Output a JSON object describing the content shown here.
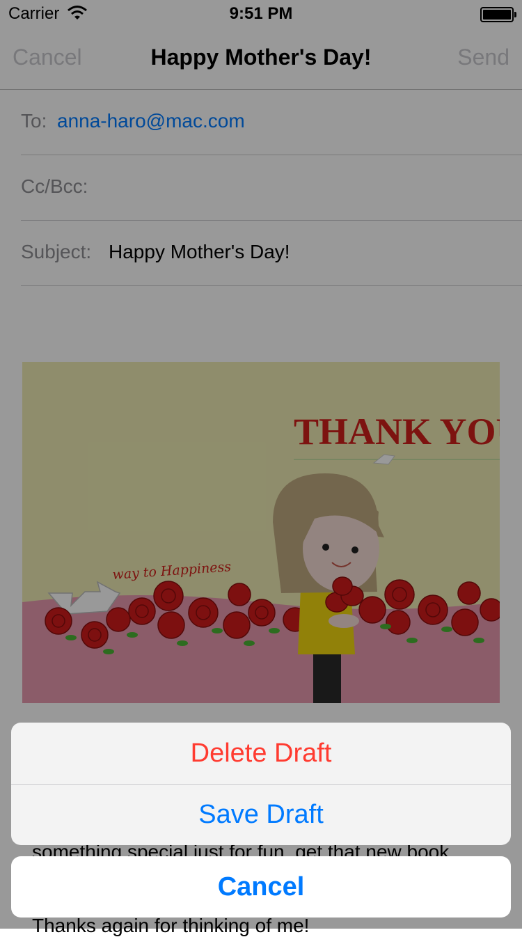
{
  "status_bar": {
    "carrier": "Carrier",
    "time": "9:51 PM",
    "battery_level": 1.0
  },
  "nav": {
    "cancel_label": "Cancel",
    "title": "Happy Mother's Day!",
    "send_label": "Send"
  },
  "fields": {
    "to_label": "To:",
    "to_value": "anna-haro@mac.com",
    "cc_label": "Cc/Bcc:",
    "subject_label": "Subject:",
    "subject_value": "Happy Mother's Day!"
  },
  "card": {
    "headline": "THANK YOU",
    "caption": "way to Happiness"
  },
  "body": {
    "line1": "something special just for fun, get that new book",
    "line2": "Thanks again for thinking of me!"
  },
  "action_sheet": {
    "delete_label": "Delete Draft",
    "save_label": "Save Draft",
    "cancel_label": "Cancel"
  },
  "colors": {
    "accent": "#007aff",
    "destructive": "#ff3b30"
  },
  "icons": [
    "wifi-icon",
    "battery-icon"
  ]
}
